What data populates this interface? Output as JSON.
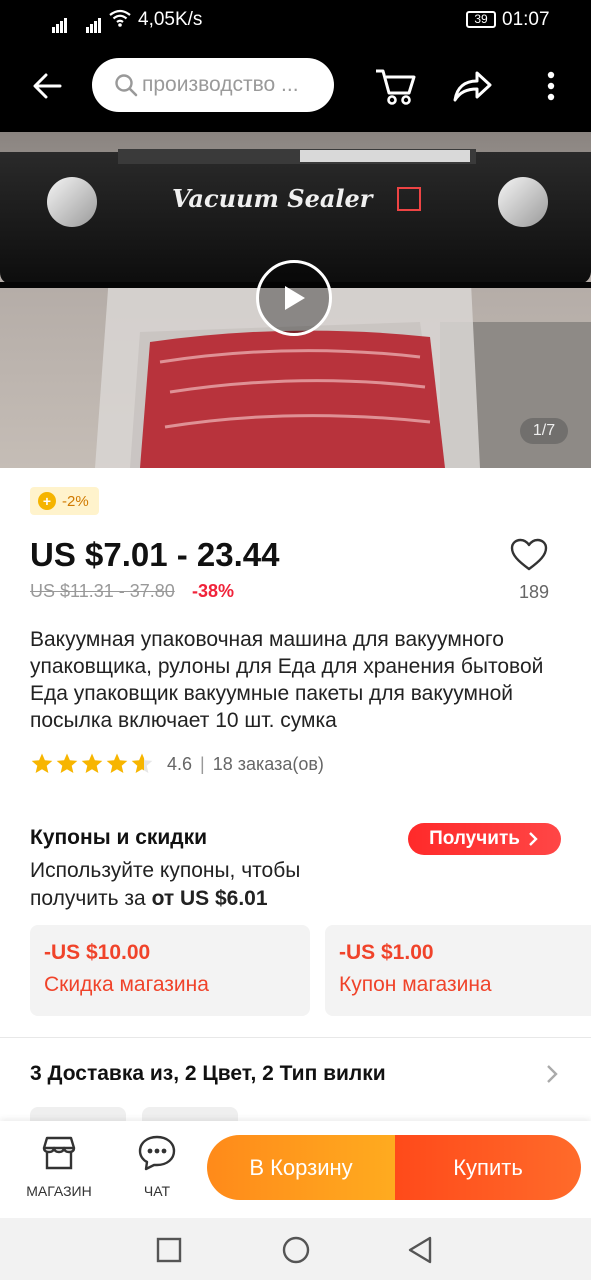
{
  "status_bar": {
    "network_speed": "4,05K/s",
    "battery": "39",
    "time": "01:07"
  },
  "top_bar": {
    "search_placeholder": "производство ...",
    "icons": [
      "back-icon",
      "search-icon",
      "cart-icon",
      "share-icon",
      "more-icon"
    ]
  },
  "gallery": {
    "counter": "1/7"
  },
  "product": {
    "coin_badge": "-2%",
    "price": "US $7.01 - 23.44",
    "old_price": "US $11.31 - 37.80",
    "discount": "-38%",
    "wishlist_count": "189",
    "title": "Вакуумная упаковочная машина для вакуумного упаковщика, рулоны для Еда для хранения бытовой Еда упаковщик вакуумные пакеты для вакуумной посылка включает 10 шт. сумка",
    "rating": "4.6",
    "stars": 4.6,
    "orders": "18 заказа(ов)"
  },
  "coupons": {
    "title": "Купоны и скидки",
    "desc_prefix": "Используйте купоны, чтобы получить за ",
    "desc_price": "от US $6.01",
    "get_button": "Получить",
    "items": [
      {
        "amount": "-US $10.00",
        "label": "Скидка магазина"
      },
      {
        "amount": "-US $1.00",
        "label": "Купон магазина"
      }
    ]
  },
  "variants": {
    "summary": "3 Доставка из, 2 Цвет, 2 Тип вилки"
  },
  "action_bar": {
    "store_label": "МАГАЗИН",
    "chat_label": "ЧАТ",
    "add_to_cart": "В Корзину",
    "buy": "Купить"
  },
  "colors": {
    "accent_red": "#f0233a",
    "cart_orange": "#ff9a1f",
    "buy_orange": "#ff5a22"
  }
}
